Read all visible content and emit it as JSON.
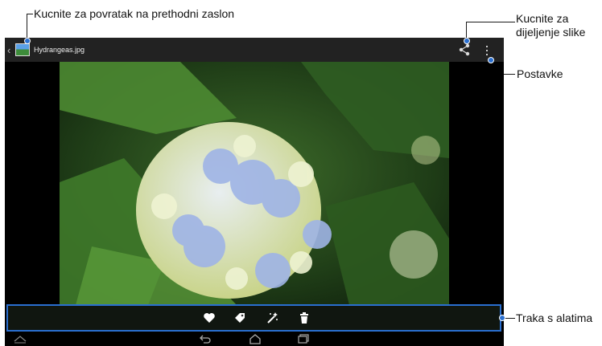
{
  "callouts": {
    "back": "Kucnite za povratak na prethodni zaslon",
    "share_line1": "Kucnite za",
    "share_line2": "dijeljenje slike",
    "settings": "Postavke",
    "toolbar": "Traka s alatima"
  },
  "action_bar": {
    "back_glyph": "‹",
    "app_icon": "gallery-image-icon",
    "title": "Hydrangeas.jpg",
    "share_icon": "share-icon",
    "menu_icon": "overflow-menu-icon"
  },
  "toolbar": {
    "items": [
      {
        "icon": "heart-icon"
      },
      {
        "icon": "tag-icon"
      },
      {
        "icon": "magic-wand-icon"
      },
      {
        "icon": "trash-icon"
      }
    ]
  },
  "nav_bar": {
    "items": [
      {
        "icon": "collapse-up-icon"
      },
      {
        "icon": "back-arrow-icon"
      },
      {
        "icon": "home-icon"
      },
      {
        "icon": "recent-apps-icon"
      }
    ]
  },
  "colors": {
    "accent": "#2a6fd0",
    "action_bar": "#222222"
  }
}
